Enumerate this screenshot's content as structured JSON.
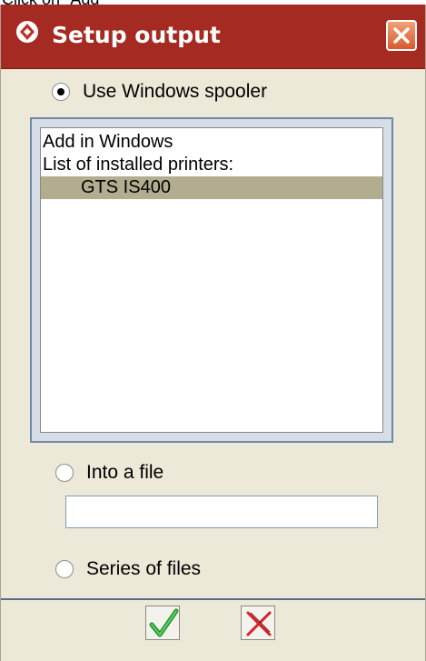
{
  "caption": "Click on \"Add\"",
  "window": {
    "title": "Setup output",
    "icons": {
      "app": "app-logo-icon",
      "close": "close-icon"
    },
    "colors": {
      "titlebar": "#a52a22",
      "dialog_bg": "#ece9d8",
      "selection": "#b2ad8f"
    }
  },
  "options": {
    "spooler_label": "Use Windows spooler",
    "file_label": "Into a file",
    "series_label": "Series of files",
    "selected": "spooler"
  },
  "printer_list": {
    "lines": [
      "Add in Windows",
      "List of installed printers:"
    ],
    "printers": [
      "GTS IS400"
    ],
    "selected_printer": "GTS IS400"
  },
  "file_input": {
    "value": ""
  },
  "buttons": {
    "ok_icon": "check-icon",
    "cancel_icon": "x-icon"
  }
}
